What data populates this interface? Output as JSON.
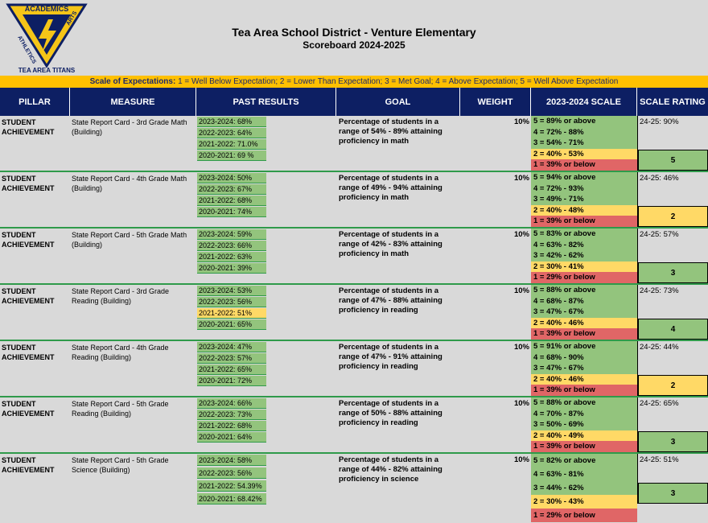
{
  "logo": {
    "top_text": "ACADEMICS",
    "left_text": "ATHLETICS",
    "right_text": "ARTS",
    "bottom_text": "TEA AREA TITANS",
    "colors": {
      "gold": "#f5c518",
      "navy": "#0d1f63"
    }
  },
  "header": {
    "title": "Tea Area School District - Venture Elementary",
    "subtitle": "Scoreboard  2024-2025"
  },
  "scale_band": {
    "label": "Scale of Expectations:",
    "text": " 1 = Well Below Expectation; 2 = Lower Than Expectation; 3 = Met Goal; 4 = Above Expectation; 5 = Well Above Expectation"
  },
  "columns": [
    "PILLAR",
    "MEASURE",
    "PAST RESULTS",
    "GOAL",
    "WEIGHT",
    "2023-2024 SCALE",
    "SCALE RATING"
  ],
  "colors": {
    "green": "#93c47d",
    "yellow": "#ffd966",
    "red": "#e06666",
    "header_navy": "#0d1f63",
    "band_gold": "#ffc000"
  },
  "rows": [
    {
      "pillar": "STUDENT ACHIEVEMENT",
      "measure": "State Report Card - 3rd Grade Math (Building)",
      "past": [
        {
          "text": "2023-2024: 68%",
          "color": "green"
        },
        {
          "text": "2022-2023: 64%",
          "color": "green"
        },
        {
          "text": "2021-2022: 71.0%",
          "color": "green"
        },
        {
          "text": "2020-2021: 69 %",
          "color": "green"
        }
      ],
      "goal": "Percentage of students in a range of 54% - 89% attaining proficiency in math",
      "weight": "10%",
      "scale": [
        {
          "text": "5 = 89% or above",
          "color": "green"
        },
        {
          "text": "4 = 72% - 88%",
          "color": "green"
        },
        {
          "text": "3 = 54% - 71%",
          "color": "green"
        },
        {
          "text": "2 = 40% - 53%",
          "color": "yellow"
        },
        {
          "text": "1 = 39% or below",
          "color": "red"
        }
      ],
      "rating_text": "24-25: 90%",
      "rating": "5",
      "rating_color": "green"
    },
    {
      "pillar": "STUDENT ACHIEVEMENT",
      "measure": "State Report Card - 4th Grade Math (Building)",
      "past": [
        {
          "text": "2023-2024: 50%",
          "color": "green"
        },
        {
          "text": "2022-2023: 67%",
          "color": "green"
        },
        {
          "text": "2021-2022: 68%",
          "color": "green"
        },
        {
          "text": "2020-2021: 74%",
          "color": "green"
        }
      ],
      "goal": "Percentage of students in a range of 49% - 94% attaining proficiency in math",
      "weight": "10%",
      "scale": [
        {
          "text": "5 = 94% or above",
          "color": "green"
        },
        {
          "text": "4 = 72% - 93%",
          "color": "green"
        },
        {
          "text": "3 = 49% - 71%",
          "color": "green"
        },
        {
          "text": "2 = 40% - 48%",
          "color": "yellow"
        },
        {
          "text": "1 = 39% or below",
          "color": "red"
        }
      ],
      "rating_text": "24-25: 46%",
      "rating": "2",
      "rating_color": "yellow"
    },
    {
      "pillar": "STUDENT ACHIEVEMENT",
      "measure": "State Report Card - 5th Grade Math (Building)",
      "past": [
        {
          "text": "2023-2024: 59%",
          "color": "green"
        },
        {
          "text": "2022-2023: 66%",
          "color": "green"
        },
        {
          "text": "2021-2022: 63%",
          "color": "green"
        },
        {
          "text": "2020-2021: 39%",
          "color": "green"
        }
      ],
      "goal": "Percentage of students in a range of 42% - 83% attaining proficiency in math",
      "weight": "10%",
      "scale": [
        {
          "text": "5 = 83% or above",
          "color": "green"
        },
        {
          "text": "4 = 63% - 82%",
          "color": "green"
        },
        {
          "text": "3 = 42% - 62%",
          "color": "green"
        },
        {
          "text": "2 = 30% - 41%",
          "color": "yellow"
        },
        {
          "text": "1 = 29% or below",
          "color": "red"
        }
      ],
      "rating_text": "24-25: 57%",
      "rating": "3",
      "rating_color": "green"
    },
    {
      "pillar": "STUDENT ACHIEVEMENT",
      "measure": "State Report Card - 3rd Grade Reading (Building)",
      "past": [
        {
          "text": "2023-2024: 53%",
          "color": "green"
        },
        {
          "text": "2022-2023: 56%",
          "color": "green"
        },
        {
          "text": "2021-2022: 51%",
          "color": "yellow"
        },
        {
          "text": "2020-2021: 65%",
          "color": "green"
        }
      ],
      "goal": "Percentage of students in a range of 47% - 88% attaining proficiency in reading",
      "weight": "10%",
      "scale": [
        {
          "text": "5 = 88% or above",
          "color": "green"
        },
        {
          "text": "4 = 68% - 87%",
          "color": "green"
        },
        {
          "text": "3 = 47% - 67%",
          "color": "green"
        },
        {
          "text": "2 = 40% - 46%",
          "color": "yellow"
        },
        {
          "text": "1 = 39% or below",
          "color": "red"
        }
      ],
      "rating_text": "24-25: 73%",
      "rating": "4",
      "rating_color": "green"
    },
    {
      "pillar": "STUDENT ACHIEVEMENT",
      "measure": "State Report Card - 4th Grade Reading (Building)",
      "past": [
        {
          "text": "2023-2024: 47%",
          "color": "green"
        },
        {
          "text": "2022-2023: 57%",
          "color": "green"
        },
        {
          "text": "2021-2022: 65%",
          "color": "green"
        },
        {
          "text": "2020-2021: 72%",
          "color": "green"
        }
      ],
      "goal": "Percentage of students in a range of 47% - 91% attaining proficiency in reading",
      "weight": "10%",
      "scale": [
        {
          "text": "5 = 91% or above",
          "color": "green"
        },
        {
          "text": "4 = 68% - 90%",
          "color": "green"
        },
        {
          "text": "3 = 47% - 67%",
          "color": "green"
        },
        {
          "text": "2 = 40% - 46%",
          "color": "yellow"
        },
        {
          "text": "1 = 39% or below",
          "color": "red"
        }
      ],
      "rating_text": "24-25: 44%",
      "rating": "2",
      "rating_color": "yellow"
    },
    {
      "pillar": "STUDENT ACHIEVEMENT",
      "measure": "State Report Card - 5th Grade Reading (Building)",
      "past": [
        {
          "text": "2023-2024: 66%",
          "color": "green"
        },
        {
          "text": "2022-2023: 73%",
          "color": "green"
        },
        {
          "text": "2021-2022: 68%",
          "color": "green"
        },
        {
          "text": "2020-2021: 64%",
          "color": "green"
        }
      ],
      "goal": "Percentage of students in a range of 50% - 88% attaining proficiency in reading",
      "weight": "10%",
      "scale": [
        {
          "text": "5 = 88% or above",
          "color": "green"
        },
        {
          "text": "4 = 70% - 87%",
          "color": "green"
        },
        {
          "text": "3 = 50% - 69%",
          "color": "green"
        },
        {
          "text": "2 = 40% - 49%",
          "color": "yellow"
        },
        {
          "text": "1 = 39% or below",
          "color": "red"
        }
      ],
      "rating_text": "24-25: 65%",
      "rating": "3",
      "rating_color": "green"
    },
    {
      "pillar": "STUDENT ACHIEVEMENT",
      "measure": "State Report Card - 5th Grade Science (Building)",
      "past": [
        {
          "text": "2023-2024: 58%",
          "color": "green"
        },
        {
          "text": "2022-2023: 56%",
          "color": "green"
        },
        {
          "text": "2021-2022: 54.39%",
          "color": "green"
        },
        {
          "text": "2020-2021: 68.42%",
          "color": "green"
        }
      ],
      "goal": "Percentage of students in a range of 44% - 82% attaining proficiency in science",
      "weight": "10%",
      "scale": [
        {
          "text": "5 = 82% or above",
          "color": "green"
        },
        {
          "text": "4 = 63% - 81%",
          "color": "green"
        },
        {
          "text": "3 = 44% - 62%",
          "color": "green"
        },
        {
          "text": "2 = 30% - 43%",
          "color": "yellow"
        },
        {
          "text": "1 = 29% or below",
          "color": "red"
        }
      ],
      "rating_text": "24-25: 51%",
      "rating": "3",
      "rating_color": "green"
    }
  ]
}
